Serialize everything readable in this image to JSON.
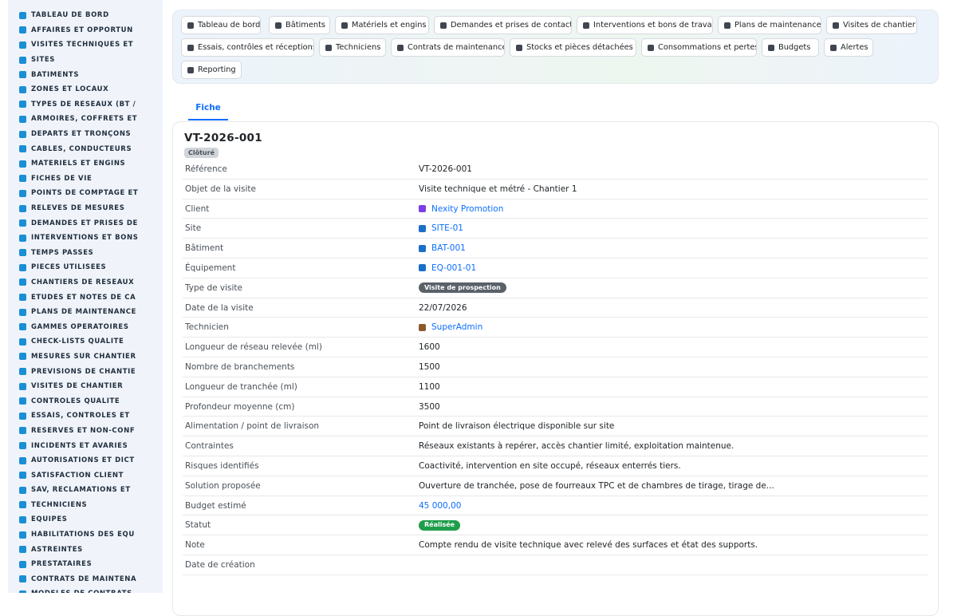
{
  "sidebar": {
    "items": [
      {
        "label": "TABLEAU DE BORD",
        "icon": "dashboard-icon"
      },
      {
        "label": "AFFAIRES ET OPPORTUN",
        "icon": "target-icon"
      },
      {
        "label": "VISITES TECHNIQUES ET",
        "icon": "clipboard-icon"
      },
      {
        "label": "SITES",
        "icon": "map-pin-icon"
      },
      {
        "label": "BÂTIMENTS",
        "icon": "building-icon"
      },
      {
        "label": "ZONES ET LOCAUX",
        "icon": "grid-icon"
      },
      {
        "label": "TYPES DE RÉSEAUX (BT /",
        "icon": "network-icon"
      },
      {
        "label": "ARMOIRES, COFFRETS ET",
        "icon": "cabinet-icon"
      },
      {
        "label": "DÉPARTS ET TRONÇONS",
        "icon": "branch-icon"
      },
      {
        "label": "CÂBLES, CONDUCTEURS",
        "icon": "cable-icon"
      },
      {
        "label": "MATÉRIELS ET ENGINS",
        "icon": "gears-icon"
      },
      {
        "label": "FICHES DE VIE",
        "icon": "history-icon"
      },
      {
        "label": "POINTS DE COMPTAGE ET",
        "icon": "meter-icon"
      },
      {
        "label": "RELEVÉS DE MESURES",
        "icon": "measure-icon"
      },
      {
        "label": "DEMANDES ET PRISES DE",
        "icon": "question-icon"
      },
      {
        "label": "INTERVENTIONS ET BONS",
        "icon": "wrench-icon"
      },
      {
        "label": "TEMPS PASSÉS",
        "icon": "clock-icon"
      },
      {
        "label": "PIÈCES UTILISÉES",
        "icon": "parts-icon"
      },
      {
        "label": "CHANTIERS DE RÉSEAUX",
        "icon": "hammer-icon"
      },
      {
        "label": "ÉTUDES ET NOTES DE CA",
        "icon": "study-icon"
      },
      {
        "label": "PLANS DE MAINTENANCE",
        "icon": "calendar-icon"
      },
      {
        "label": "GAMMES OPÉRATOIRES",
        "icon": "list-icon"
      },
      {
        "label": "CHECK-LISTS QUALITÉ",
        "icon": "checklist-icon"
      },
      {
        "label": "MESURES SUR CHANTIER",
        "icon": "thermometer-icon"
      },
      {
        "label": "PRÉVISIONS DE CHANTIE",
        "icon": "chart-icon"
      },
      {
        "label": "VISITES DE CHANTIER",
        "icon": "route-icon"
      },
      {
        "label": "CONTRÔLES QUALITÉ",
        "icon": "search-icon"
      },
      {
        "label": "ESSAIS, CONTRÔLES ET",
        "icon": "clipboard-check-icon"
      },
      {
        "label": "RÉSERVES ET NON-CONF",
        "icon": "alert-circle-icon"
      },
      {
        "label": "INCIDENTS ET AVARIES",
        "icon": "warning-icon"
      },
      {
        "label": "AUTORISATIONS ET DICT",
        "icon": "file-signature-icon"
      },
      {
        "label": "SATISFACTION CLIENT",
        "icon": "smile-icon"
      },
      {
        "label": "SAV, RÉCLAMATIONS ET",
        "icon": "headset-icon"
      },
      {
        "label": "TECHNICIENS",
        "icon": "hardhat-icon"
      },
      {
        "label": "ÉQUIPES",
        "icon": "users-icon"
      },
      {
        "label": "HABILITATIONS DES ÉQU",
        "icon": "badge-icon"
      },
      {
        "label": "ASTREINTES",
        "icon": "phone-icon"
      },
      {
        "label": "PRESTATAIRES",
        "icon": "handshake-icon"
      },
      {
        "label": "CONTRATS DE MAINTENA",
        "icon": "file-contract-icon"
      },
      {
        "label": "MODÈLES DE CONTRATS",
        "icon": "file-icon"
      }
    ]
  },
  "topnav": {
    "buttons": [
      {
        "label": "Tableau de bord",
        "icon": "dashboard-icon"
      },
      {
        "label": "Bâtiments",
        "icon": "building-icon"
      },
      {
        "label": "Matériels et engins",
        "icon": "gears-icon"
      },
      {
        "label": "Demandes et prises de contact",
        "icon": "question-icon"
      },
      {
        "label": "Interventions et bons de travaux",
        "icon": "clipboard-icon"
      },
      {
        "label": "Plans de maintenance",
        "icon": "calendar-icon"
      },
      {
        "label": "Visites de chantier",
        "icon": "route-icon"
      },
      {
        "label": "Essais, contrôles et réceptions",
        "icon": "clipboard-check-icon"
      },
      {
        "label": "Techniciens",
        "icon": "hardhat-icon"
      },
      {
        "label": "Contrats de maintenance",
        "icon": "file-contract-icon"
      },
      {
        "label": "Stocks et pièces détachées",
        "icon": "boxes-icon"
      },
      {
        "label": "Consommations et pertes",
        "icon": "bolt-icon"
      },
      {
        "label": "Budgets",
        "icon": "money-icon"
      },
      {
        "label": "Alertes",
        "icon": "bell-icon"
      },
      {
        "label": "Reporting",
        "icon": "pie-chart-icon"
      }
    ]
  },
  "tab": {
    "label": "Fiche"
  },
  "record": {
    "title": "VT-2026-001",
    "status_badge": "Clôturé",
    "fields": [
      {
        "label": "Référence",
        "value": "VT-2026-001",
        "kind": "text"
      },
      {
        "label": "Objet de la visite",
        "value": "Visite technique et métré - Chantier 1",
        "kind": "text"
      },
      {
        "label": "Client",
        "value": "Nexity Promotion",
        "kind": "link",
        "icon": "building-icon",
        "icon_color": "#7b3fe4"
      },
      {
        "label": "Site",
        "value": "SITE-01",
        "kind": "link",
        "icon": "network-icon",
        "icon_color": "#1a6fc9"
      },
      {
        "label": "Bâtiment",
        "value": "BAT-001",
        "kind": "link",
        "icon": "network-icon",
        "icon_color": "#1a6fc9"
      },
      {
        "label": "Équipement",
        "value": "EQ-001-01",
        "kind": "link",
        "icon": "network-icon",
        "icon_color": "#1a6fc9"
      },
      {
        "label": "Type de visite",
        "value": "Visite de prospection",
        "kind": "pill",
        "pill_color": "#5a6169"
      },
      {
        "label": "Date de la visite",
        "value": "22/07/2026",
        "kind": "text"
      },
      {
        "label": "Technicien",
        "value": "SuperAdmin",
        "kind": "link",
        "icon": "user-icon",
        "icon_color": "#8a5a2b"
      },
      {
        "label": "Longueur de réseau relevée (ml)",
        "value": "1600",
        "kind": "text"
      },
      {
        "label": "Nombre de branchements",
        "value": "1500",
        "kind": "text"
      },
      {
        "label": "Longueur de tranchée (ml)",
        "value": "1100",
        "kind": "text"
      },
      {
        "label": "Profondeur moyenne (cm)",
        "value": "3500",
        "kind": "text"
      },
      {
        "label": "Alimentation / point de livraison",
        "value": "Point de livraison électrique disponible sur site",
        "kind": "text"
      },
      {
        "label": "Contraintes",
        "value": "Réseaux existants à repérer, accès chantier limité, exploitation maintenue.",
        "kind": "text"
      },
      {
        "label": "Risques identifiés",
        "value": "Coactivité, intervention en site occupé, réseaux enterrés tiers.",
        "kind": "text"
      },
      {
        "label": "Solution proposée",
        "value": "Ouverture de tranchée, pose de fourreaux TPC et de chambres de tirage, tirage de...",
        "kind": "text"
      },
      {
        "label": "Budget estimé",
        "value": "45 000,00",
        "kind": "link-plain"
      },
      {
        "label": "Statut",
        "value": "Réalisée",
        "kind": "pill",
        "pill_color": "#1e9e4a"
      },
      {
        "label": "Note",
        "value": "Compte rendu de visite technique avec relevé des surfaces et état des supports.",
        "kind": "text"
      },
      {
        "label": "Date de création",
        "value": "",
        "kind": "text"
      }
    ]
  },
  "colors": {
    "accent": "#0d6efd",
    "sidebar_bg": "#f0f4fa",
    "sidebar_icon": "#1a8fd6"
  }
}
